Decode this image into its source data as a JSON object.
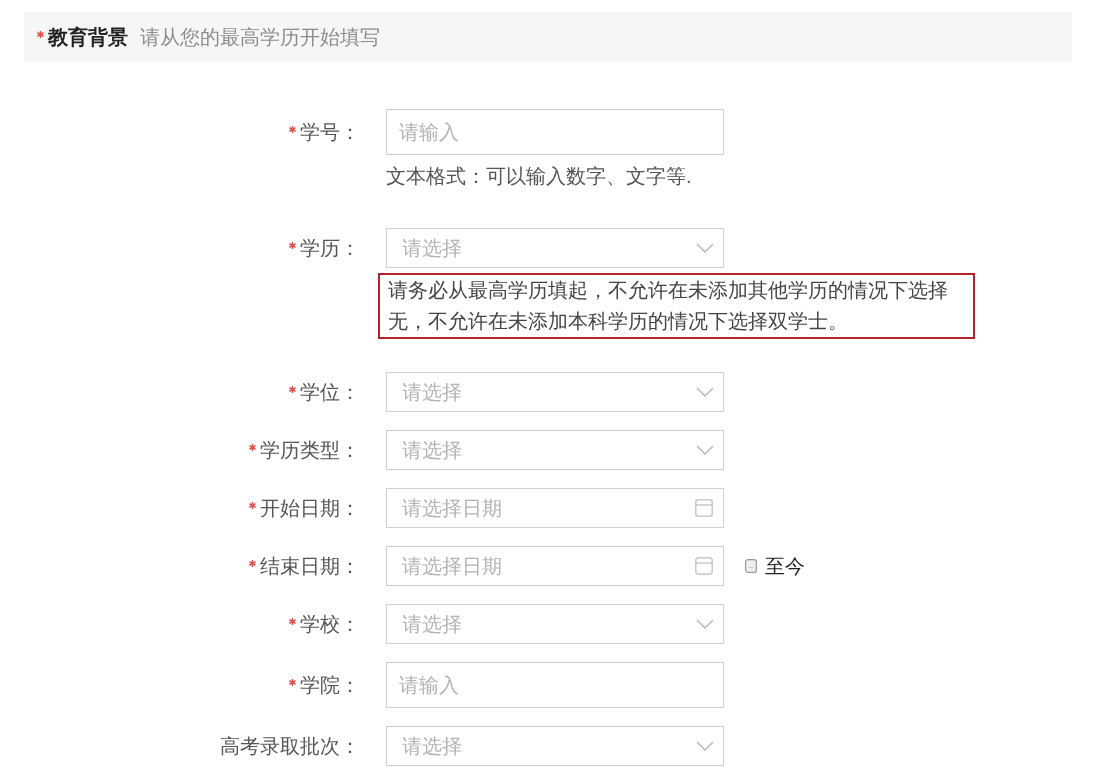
{
  "section": {
    "required": true,
    "title": "教育背景",
    "subtitle": "请从您的最高学历开始填写"
  },
  "fields": [
    {
      "kind": "input",
      "required": true,
      "label": "学号：",
      "placeholder": "请输入",
      "help": "文本格式：可以输入数字、文字等."
    },
    {
      "kind": "select",
      "required": true,
      "label": "学历：",
      "placeholder": "请选择",
      "notice": "请务必从最高学历填起，不允许在未添加其他学历的情况下选择无，不允许在未添加本科学历的情况下选择双学士。"
    },
    {
      "kind": "select",
      "required": true,
      "label": "学位：",
      "placeholder": "请选择"
    },
    {
      "kind": "select",
      "required": true,
      "label": "学历类型：",
      "placeholder": "请选择"
    },
    {
      "kind": "date",
      "required": true,
      "label": "开始日期：",
      "placeholder": "请选择日期"
    },
    {
      "kind": "date",
      "required": true,
      "label": "结束日期：",
      "placeholder": "请选择日期",
      "checkbox": {
        "label": "至今",
        "checked": false
      }
    },
    {
      "kind": "select",
      "required": true,
      "label": "学校：",
      "placeholder": "请选择"
    },
    {
      "kind": "input",
      "required": true,
      "label": "学院：",
      "placeholder": "请输入"
    },
    {
      "kind": "select",
      "required": false,
      "label": "高考录取批次：",
      "placeholder": "请选择"
    }
  ]
}
